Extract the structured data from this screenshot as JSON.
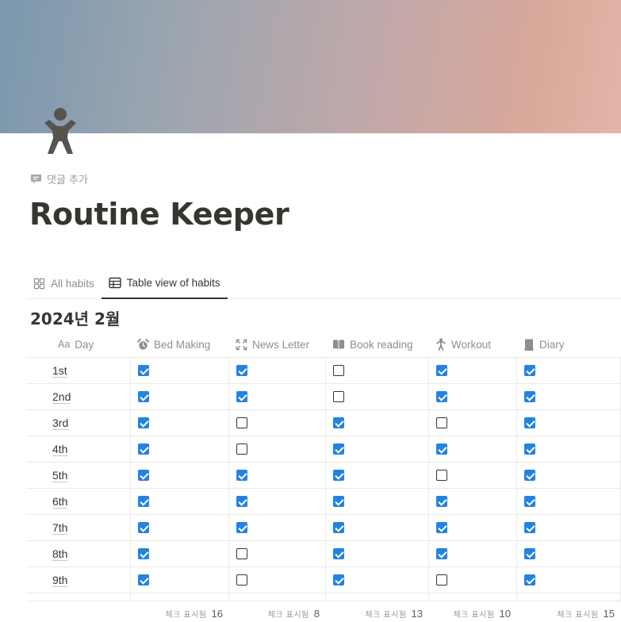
{
  "page": {
    "comment_label": "댓글 추가",
    "title": "Routine Keeper"
  },
  "tabs": [
    {
      "label": "All habits",
      "icon": "gallery-icon",
      "active": false
    },
    {
      "label": "Table view of habits",
      "icon": "table-icon",
      "active": true
    }
  ],
  "group": {
    "title": "2024년 2월"
  },
  "table": {
    "columns": [
      {
        "key": "day",
        "label": "Day",
        "prefix": "Aa",
        "icon": "title-property-icon"
      },
      {
        "key": "bed_making",
        "label": "Bed Making",
        "icon": "alarm-clock-icon"
      },
      {
        "key": "news_letter",
        "label": "News Letter",
        "icon": "expand-icon"
      },
      {
        "key": "book_reading",
        "label": "Book reading",
        "icon": "book-icon"
      },
      {
        "key": "workout",
        "label": "Workout",
        "icon": "person-walking-icon"
      },
      {
        "key": "diary",
        "label": "Diary",
        "icon": "notebook-icon"
      }
    ],
    "rows": [
      {
        "day": "1st",
        "checks": [
          true,
          true,
          false,
          true,
          true
        ]
      },
      {
        "day": "2nd",
        "checks": [
          true,
          true,
          false,
          true,
          true
        ]
      },
      {
        "day": "3rd",
        "checks": [
          true,
          false,
          true,
          false,
          true
        ]
      },
      {
        "day": "4th",
        "checks": [
          true,
          false,
          true,
          true,
          true
        ]
      },
      {
        "day": "5th",
        "checks": [
          true,
          true,
          true,
          false,
          true
        ]
      },
      {
        "day": "6th",
        "checks": [
          true,
          true,
          true,
          true,
          true
        ]
      },
      {
        "day": "7th",
        "checks": [
          true,
          true,
          true,
          true,
          true
        ]
      },
      {
        "day": "8th",
        "checks": [
          true,
          false,
          true,
          true,
          true
        ]
      },
      {
        "day": "9th",
        "checks": [
          true,
          false,
          true,
          false,
          true
        ]
      }
    ],
    "footer": [
      {
        "label": "체크 표시됨",
        "value": "16"
      },
      {
        "label": "체크 표시됨",
        "value": "8"
      },
      {
        "label": "체크 표시됨",
        "value": "13"
      },
      {
        "label": "체크 표시됨",
        "value": "10"
      },
      {
        "label": "체크 표시됨",
        "value": "15"
      }
    ]
  },
  "colors": {
    "checkbox_checked": "#2383e2",
    "text_primary": "#37352f",
    "text_muted": "#8f8e8a",
    "cover_left": "#7a98ae",
    "cover_right": "#e2b5a8"
  }
}
